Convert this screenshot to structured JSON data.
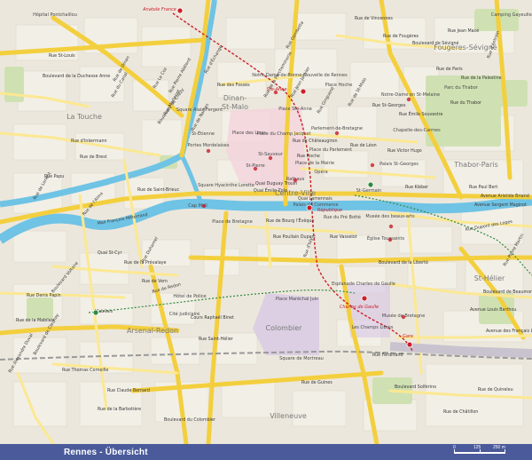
{
  "footer": {
    "title": "Rennes - Übersicht",
    "scale_labels": [
      "0",
      "125",
      "250 m"
    ]
  },
  "districts": [
    "La Touche",
    "Dinan-St-Malo",
    "Centre-Ville",
    "Thabor-Paris",
    "Fougères-Sévigné",
    "St-Hélier",
    "Arsenal-Redon",
    "Colombier",
    "Villeneuve"
  ],
  "landmarks": [
    "Hôpital Pontchaillou",
    "Camping Gayeulles",
    "Notre-Dame-de-Bonne-Nouvelle de Rennes",
    "Notre-Dame en St-Melaine",
    "Parc du Thabor",
    "Chapelle-des-Carmes",
    "Parlement-de-Bretagne",
    "Palais St-Georges",
    "Église Toussaints",
    "Musée des beaux-arts",
    "Palais du Commerce",
    "Opéra",
    "Rathaus",
    "Place de la Mairie",
    "République",
    "Cap Mail",
    "Portes Mordelaises",
    "St-Sauveur",
    "St-Pierre",
    "St-Étienne",
    "Esplanade Charles de Gaulle",
    "Charles de Gaulle",
    "Musée de Bretagne",
    "Les Champs Libres",
    "Gare",
    "Place Maréchal Juin",
    "Square de Mortreau",
    "Hôtel de Police",
    "Cité Judiciaire",
    "Mabilais",
    "Ste-Anne",
    "Place Ste-Anne",
    "Place des Lices",
    "Place Hoche",
    "Place du Champ Jacquet",
    "Rue du Pré Botté",
    "Place du Parlement",
    "Anatole France",
    "St-Germain",
    "Square Alain Fergent",
    "Place de Bretagne",
    "Square Hyacinthe Lorette"
  ],
  "streets": [
    "Rue de Vincennes",
    "Rue de Fougères",
    "Boulevard de Sévigné",
    "Rue Jean Macé",
    "Rue de Paris",
    "Rue de la Palestine",
    "Rue du Thabor",
    "Rue Victor Hugo",
    "Rue Kléber",
    "Rue Paul Bert",
    "Avenue Aristide Briand",
    "Avenue Sergent Maginot",
    "Rue Dupont des Loges",
    "Quai Lamennais",
    "Quai Duguay Trouin",
    "Quai Émile Zola",
    "Boulevard de la Liberté",
    "Rue Poullain Duparc",
    "Rue Vasselot",
    "Rue de Nantes",
    "Rue d'Échange",
    "Boulevard de Chézy",
    "Rue de Brest",
    "Rue Papu",
    "Rue de Lorient",
    "Mail François Mitterrand",
    "Quai St-Cyr",
    "Rue de la Prévalaye",
    "Rue de Redon",
    "Rue de Vern",
    "Rue Denis Papin",
    "Boulevard Voltaire",
    "Rue de la Mabilais",
    "Boulevard de Cleunay",
    "Rue Alexandre Duval",
    "Rue Thomas Corneille",
    "Rue Claude Bernard",
    "Rue de la Barbotière",
    "Rue de Guines",
    "Boulevard du Colombier",
    "Rue Ferdinand",
    "Boulevard de Beaumont",
    "Avenue Louis Barthou",
    "Avenue des Français Libres",
    "Boulevard Solférino",
    "Rue de Châtillon",
    "Rue de Quineleu",
    "Rue Pierre Martin",
    "Rue Saint-Hélier",
    "Cours Raphaël Binet",
    "Rue Pierre Abélard",
    "Rue de St-Malo",
    "Rue d'Antrain",
    "Boulevard de la Duchesse Anne",
    "Rue Le Coz",
    "Rue de Dinan",
    "Rue du Canal",
    "Rue Martenot",
    "Rue St-Louis",
    "Rue d'Inkermann",
    "Rue de Saint-Brieuc",
    "Rue Duhamel",
    "Rue de l'Alma",
    "Rue Ginguené",
    "Rue Jean Janvier",
    "Rue Émile Souvestre",
    "Rue d'Isly",
    "Rue de Châteaugiron",
    "Rue de la Parcheminerie",
    "Rue de Léon",
    "Rue St-Georges",
    "Rue Hoche",
    "Rue Gambetta",
    "Rue des Fossés",
    "Rue de Bourg l'Évêque"
  ],
  "metro_stations": [
    "Anatole France",
    "Ste-Anne",
    "République",
    "Charles de Gaulle",
    "Gare",
    "St-Germain",
    "Mabilais"
  ],
  "colors": {
    "background": "#ece7dc",
    "built": "#f2efe6",
    "park": "#cfe1b2",
    "water": "#6fc3e5",
    "major_road": "#f3cf3e",
    "primary_road": "#fbe892",
    "pedestrian": "#ecaac4",
    "metro": "#cc1f28",
    "footer": "#4a5a9a"
  }
}
